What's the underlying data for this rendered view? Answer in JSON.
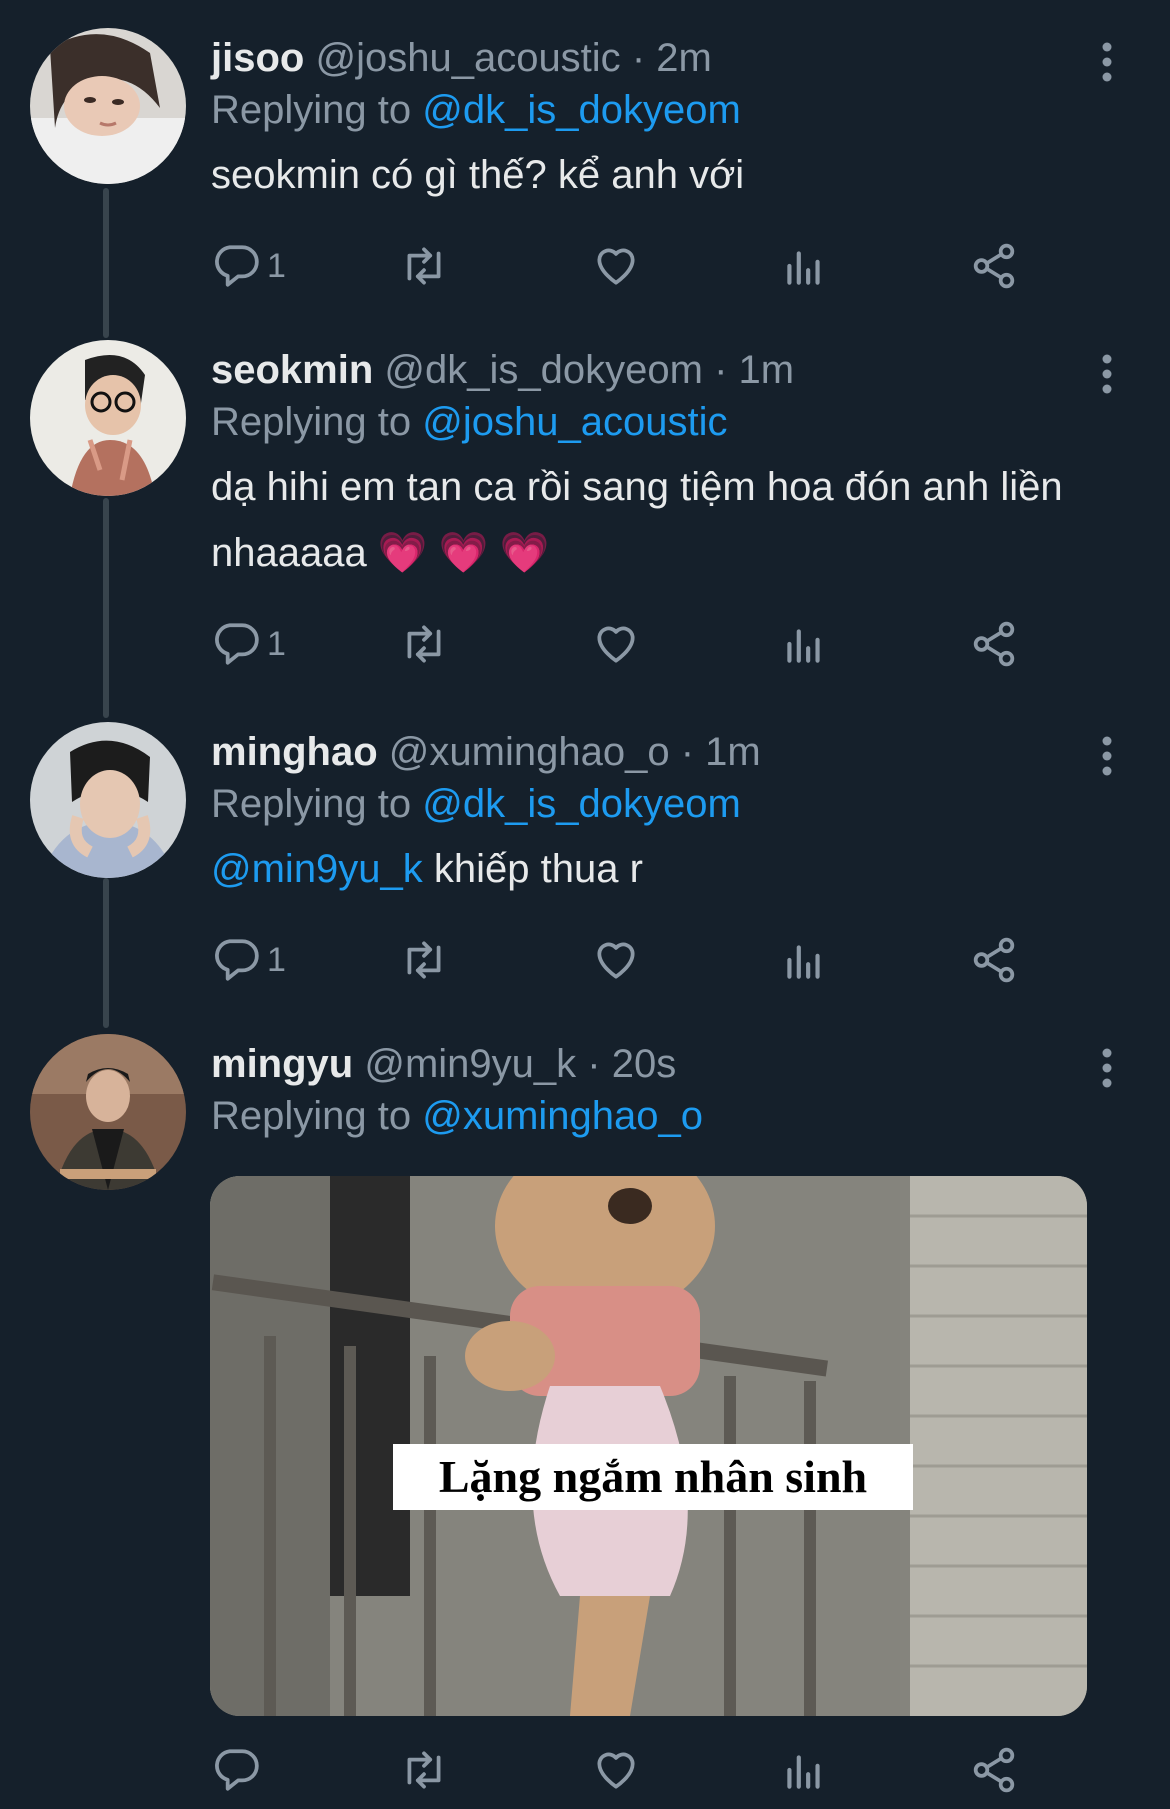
{
  "colors": {
    "background": "#15202b",
    "text": "#e7e9ea",
    "muted": "#8b98a5",
    "accent": "#1d9bf0",
    "thread_line": "#38444d"
  },
  "tweets": [
    {
      "name": "jisoo",
      "handle": "@joshu_acoustic",
      "dot": "·",
      "time": "2m",
      "replying_label": "Replying to",
      "replying_to": "@dk_is_dokyeom",
      "text": "seokmin có gì thế? kể anh với",
      "reply_count": "1"
    },
    {
      "name": "seokmin",
      "handle": "@dk_is_dokyeom",
      "dot": "·",
      "time": "1m",
      "replying_label": "Replying to",
      "replying_to": "@joshu_acoustic",
      "text": "dạ hihi em tan ca rồi sang tiệm hoa đón anh liền nhaaaaa 💗 💗 💗",
      "reply_count": "1"
    },
    {
      "name": "minghao",
      "handle": "@xuminghao_o",
      "dot": "·",
      "time": "1m",
      "replying_label": "Replying to",
      "replying_to": "@dk_is_dokyeom",
      "text_mention": "@min9yu_k",
      "text": " khiếp thua r",
      "reply_count": "1"
    },
    {
      "name": "mingyu",
      "handle": "@min9yu_k",
      "dot": "·",
      "time": "20s",
      "replying_label": "Replying to",
      "replying_to": "@xuminghao_o",
      "media_caption": "Lặng ngắm nhân sinh",
      "reply_count": ""
    }
  ],
  "icons": {
    "reply": "reply-icon",
    "retweet": "retweet-icon",
    "like": "heart-icon",
    "views": "analytics-icon",
    "share": "share-icon",
    "more": "more-icon"
  }
}
